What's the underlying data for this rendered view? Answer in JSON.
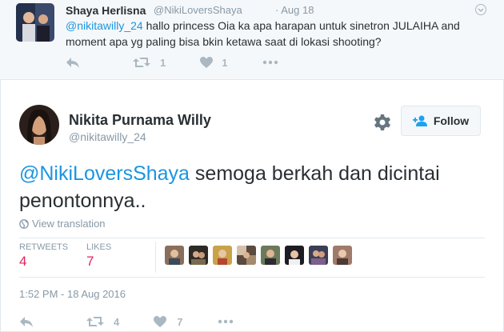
{
  "reply_tweet": {
    "name": "Shaya Herlisna",
    "handle": "@NikiLoversShaya",
    "date": "· Aug 18",
    "mention": "@nikitawilly_24",
    "text": " hallo princess Oia ka apa harapan untuk sinetron JULAIHA and moment apa yg paling bisa bkin ketawa saat di lokasi shooting?",
    "retweet_count": "1",
    "like_count": "1"
  },
  "main_tweet": {
    "name": "Nikita Purnama Willy",
    "handle": "@nikitawilly_24",
    "follow_label": "Follow",
    "mention": "@NikiLoversShaya",
    "text": " semoga berkah dan dicintai penontonnya..",
    "translate_label": "View translation",
    "retweets_label": "RETWEETS",
    "retweets_count": "4",
    "likes_label": "LIKES",
    "likes_count": "7",
    "timestamp": "1:52 PM - 18 Aug 2016",
    "retweet_action_count": "4",
    "like_action_count": "7"
  },
  "likers": [
    "liker-1",
    "liker-2",
    "liker-3",
    "liker-4",
    "liker-5",
    "liker-6",
    "liker-7",
    "liker-8"
  ],
  "colors": {
    "link": "#1b95e0",
    "accent": "#1da1f2",
    "stat_number": "#e0245e",
    "muted": "#8899a6",
    "icon": "#aab8c2"
  },
  "icons": [
    "reply-icon",
    "retweet-icon",
    "heart-icon",
    "more-icon",
    "gear-icon",
    "follow-person-icon",
    "globe-icon",
    "caret-icon"
  ]
}
